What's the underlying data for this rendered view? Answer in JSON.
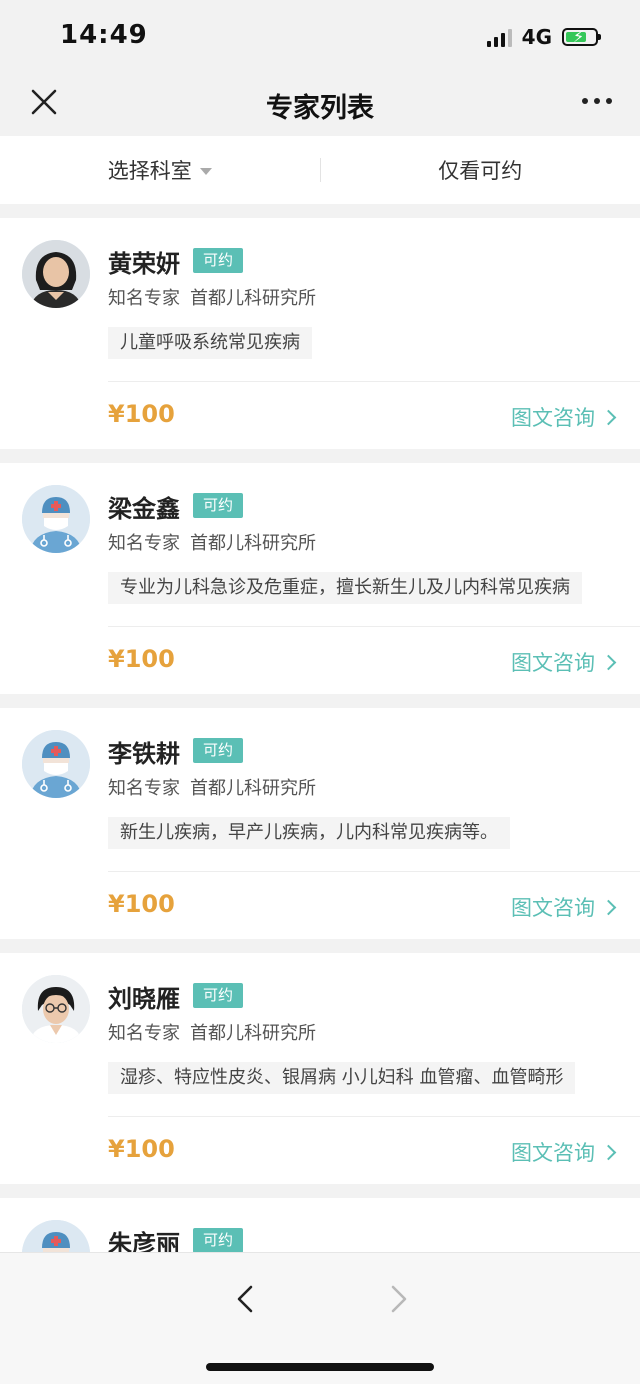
{
  "status_bar": {
    "time": "14:49",
    "network": "4G"
  },
  "nav": {
    "title": "专家列表"
  },
  "filters": {
    "department": "选择科室",
    "available_only": "仅看可约"
  },
  "colors": {
    "accent": "#5bbfb5",
    "price": "#e6a23c"
  },
  "experts": [
    {
      "name": "黄荣妍",
      "status": "可约",
      "title": "知名专家",
      "hospital": "首都儿科研究所",
      "specialty": "儿童呼吸系统常见疾病",
      "price": "¥100",
      "action": "图文咨询",
      "avatar": "photo-female"
    },
    {
      "name": "梁金鑫",
      "status": "可约",
      "title": "知名专家",
      "hospital": "首都儿科研究所",
      "specialty": "专业为儿科急诊及危重症，擅长新生儿及儿内科常见疾病",
      "price": "¥100",
      "action": "图文咨询",
      "avatar": "doctor-placeholder"
    },
    {
      "name": "李铁耕",
      "status": "可约",
      "title": "知名专家",
      "hospital": "首都儿科研究所",
      "specialty": "新生儿疾病，早产儿疾病，儿内科常见疾病等。",
      "price": "¥100",
      "action": "图文咨询",
      "avatar": "doctor-placeholder"
    },
    {
      "name": "刘晓雁",
      "status": "可约",
      "title": "知名专家",
      "hospital": "首都儿科研究所",
      "specialty": "湿疹、特应性皮炎、银屑病 小儿妇科 血管瘤、血管畸形",
      "price": "¥100",
      "action": "图文咨询",
      "avatar": "photo-female-glasses"
    },
    {
      "name": "朱彦丽",
      "status": "可约",
      "title": "",
      "hospital": "",
      "specialty": "",
      "price": "",
      "action": "",
      "avatar": "doctor-placeholder"
    }
  ]
}
